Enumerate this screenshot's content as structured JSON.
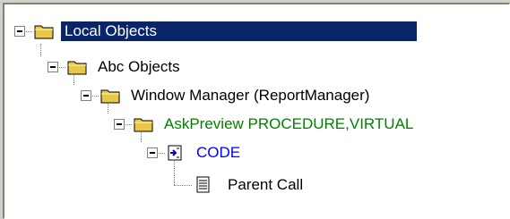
{
  "tree": {
    "nodes": [
      {
        "label": "Local Objects",
        "icon": "folder-icon",
        "expanded": true,
        "selected": true,
        "color": "#ffffff"
      },
      {
        "label": "Abc Objects",
        "icon": "folder-icon",
        "expanded": true,
        "selected": false,
        "color": "#000000"
      },
      {
        "label": "Window Manager (ReportManager)",
        "icon": "folder-icon",
        "expanded": true,
        "selected": false,
        "color": "#000000"
      },
      {
        "label": "AskPreview PROCEDURE,VIRTUAL",
        "icon": "folder-icon",
        "expanded": true,
        "selected": false,
        "color": "#008000"
      },
      {
        "label": "CODE",
        "icon": "code-embed-icon",
        "expanded": true,
        "selected": false,
        "color": "#0000ff"
      },
      {
        "label": "Parent Call",
        "icon": "page-icon",
        "expanded": false,
        "selected": false,
        "color": "#000000"
      }
    ],
    "selection_color": "#0a246a"
  }
}
